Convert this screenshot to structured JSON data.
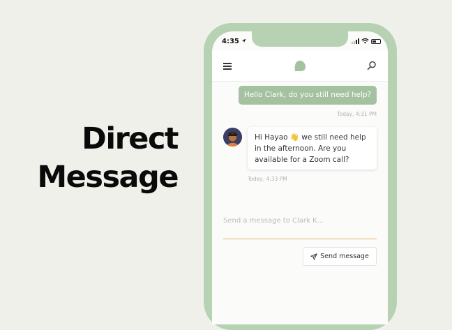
{
  "headline": {
    "line1": "Direct",
    "line2": "Message"
  },
  "status": {
    "time": "4:35"
  },
  "chat": {
    "outgoing": {
      "text": "Hello Clark, do you still need help?",
      "timestamp": "Today, 4:31 PM"
    },
    "incoming": {
      "line1": "Hi Hayao 👋 we still need help",
      "line2": "in the afternoon. Are you",
      "line3": "available for a Zoom call?",
      "timestamp": "Today, 4:33 PM"
    }
  },
  "composer": {
    "placeholder": "Send a message to Clark K...",
    "send_label": "Send message"
  },
  "colors": {
    "accent_green": "#a4c29f",
    "phone_frame": "#b7d2b3",
    "input_underline": "#e8b46a",
    "background": "#f0f0eb"
  }
}
